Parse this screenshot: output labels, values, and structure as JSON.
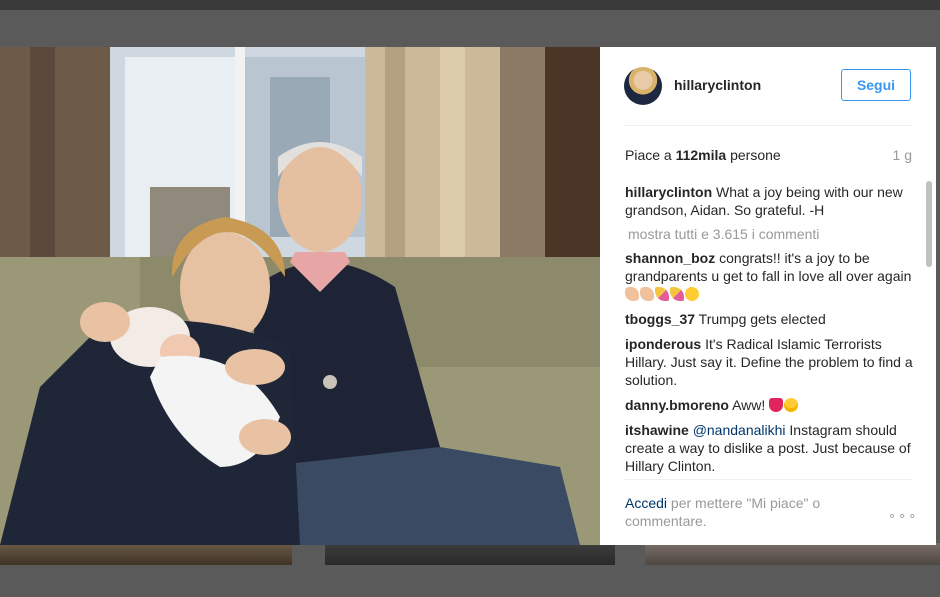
{
  "post": {
    "username": "hillaryclinton",
    "follow_label": "Segui",
    "likes_prefix": "Piace a ",
    "likes_count": "112mila",
    "likes_suffix": " persone",
    "time_ago": "1 g",
    "view_all_comments": "mostra tutti e 3.615 i commenti"
  },
  "caption": {
    "user": "hillaryclinton",
    "text": "What a joy being with our new grandson, Aidan. So grateful. -H"
  },
  "comments": [
    {
      "user": "shannon_boz",
      "text": "congrats!! it's a joy to be grandparents u get to fall in love all over again",
      "emoji": [
        "clap",
        "clap",
        "party",
        "party",
        "smile"
      ]
    },
    {
      "user": "tboggs_37",
      "text": "Trumpg gets elected",
      "emoji": []
    },
    {
      "user": "iponderous",
      "text": "It's Radical Islamic Terrorists Hillary. Just say it. Define the problem to find a solution.",
      "emoji": []
    },
    {
      "user": "danny.bmoreno",
      "text": "Aww!",
      "emoji": [
        "heart",
        "heart-eyes"
      ]
    },
    {
      "user": "itshawine",
      "mention": "@nandanalikhi",
      "text": "Instagram should create a way to dislike a post. Just because of Hillary Clinton.",
      "emoji": []
    }
  ],
  "footer": {
    "login_link": "Accedi",
    "login_text": " per mettere \"Mi piace\" o commentare.",
    "more_options": "∘∘∘"
  },
  "colors": {
    "accent": "#3897f0",
    "link": "#003569",
    "muted": "#999999",
    "text": "#262626"
  }
}
